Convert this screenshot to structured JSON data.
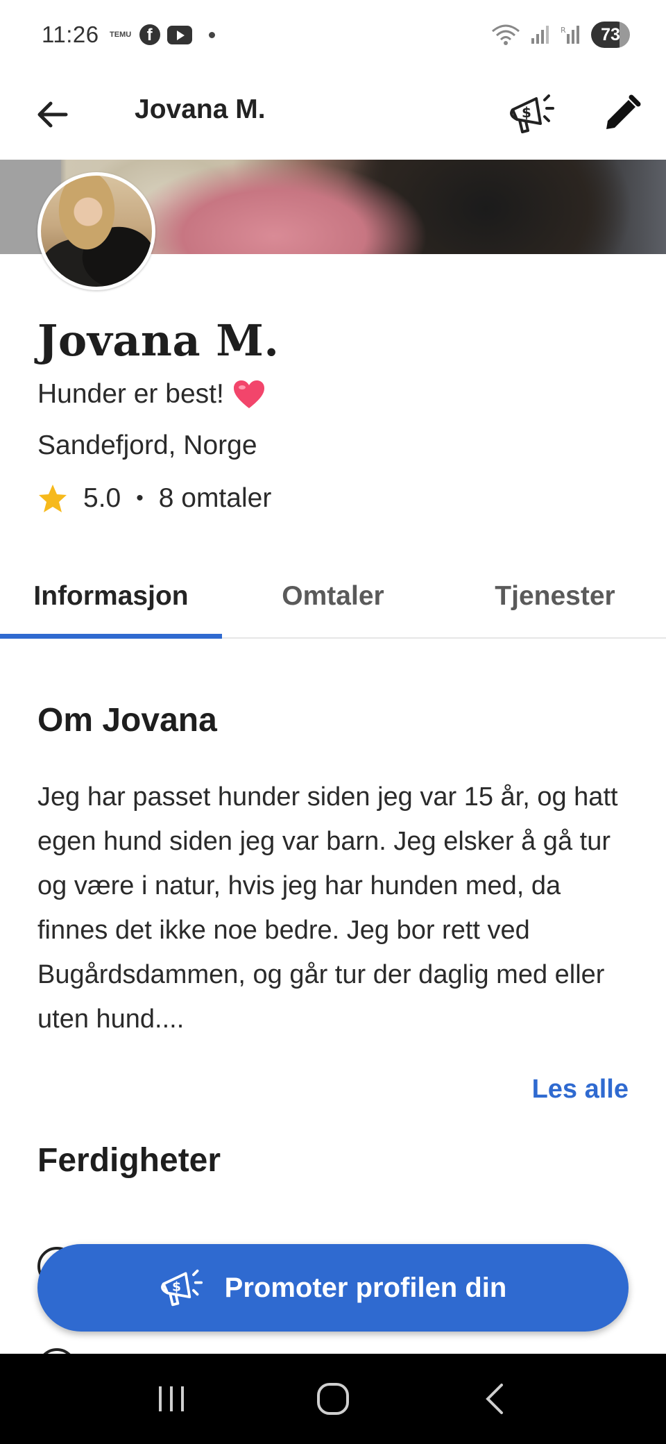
{
  "status_bar": {
    "time": "11:26",
    "temu_label": "TEMU",
    "battery": "73"
  },
  "app_bar": {
    "title": "Jovana M.",
    "icons": [
      "back-arrow-icon",
      "megaphone-dollar-icon",
      "pencil-icon"
    ]
  },
  "profile": {
    "name": "Jovana M.",
    "tagline": "Hunder er best!",
    "location": "Sandefjord, Norge",
    "rating": "5.0",
    "separator": "•",
    "reviews": "8 omtaler",
    "colors": {
      "star": "#f6b91c",
      "heart": "#f2456b"
    }
  },
  "tabs": [
    {
      "label": "Informasjon",
      "active": true
    },
    {
      "label": "Omtaler",
      "active": false
    },
    {
      "label": "Tjenester",
      "active": false
    }
  ],
  "about": {
    "title": "Om Jovana",
    "text": "Jeg har passet hunder siden jeg var 15 år, og hatt egen hund siden jeg var barn. Jeg elsker å gå tur og være i natur, hvis jeg har hunden med, da finnes det ikke noe bedre. Jeg bor rett ved Bugårdsdammen, og går tur der daglig med eller uten hund....",
    "read_all": "Les alle"
  },
  "skills": {
    "title": "Ferdigheter"
  },
  "promote_button": {
    "label": "Promoter profilen din"
  },
  "theme": {
    "accent": "#2f6ad0",
    "text": "#222222"
  }
}
